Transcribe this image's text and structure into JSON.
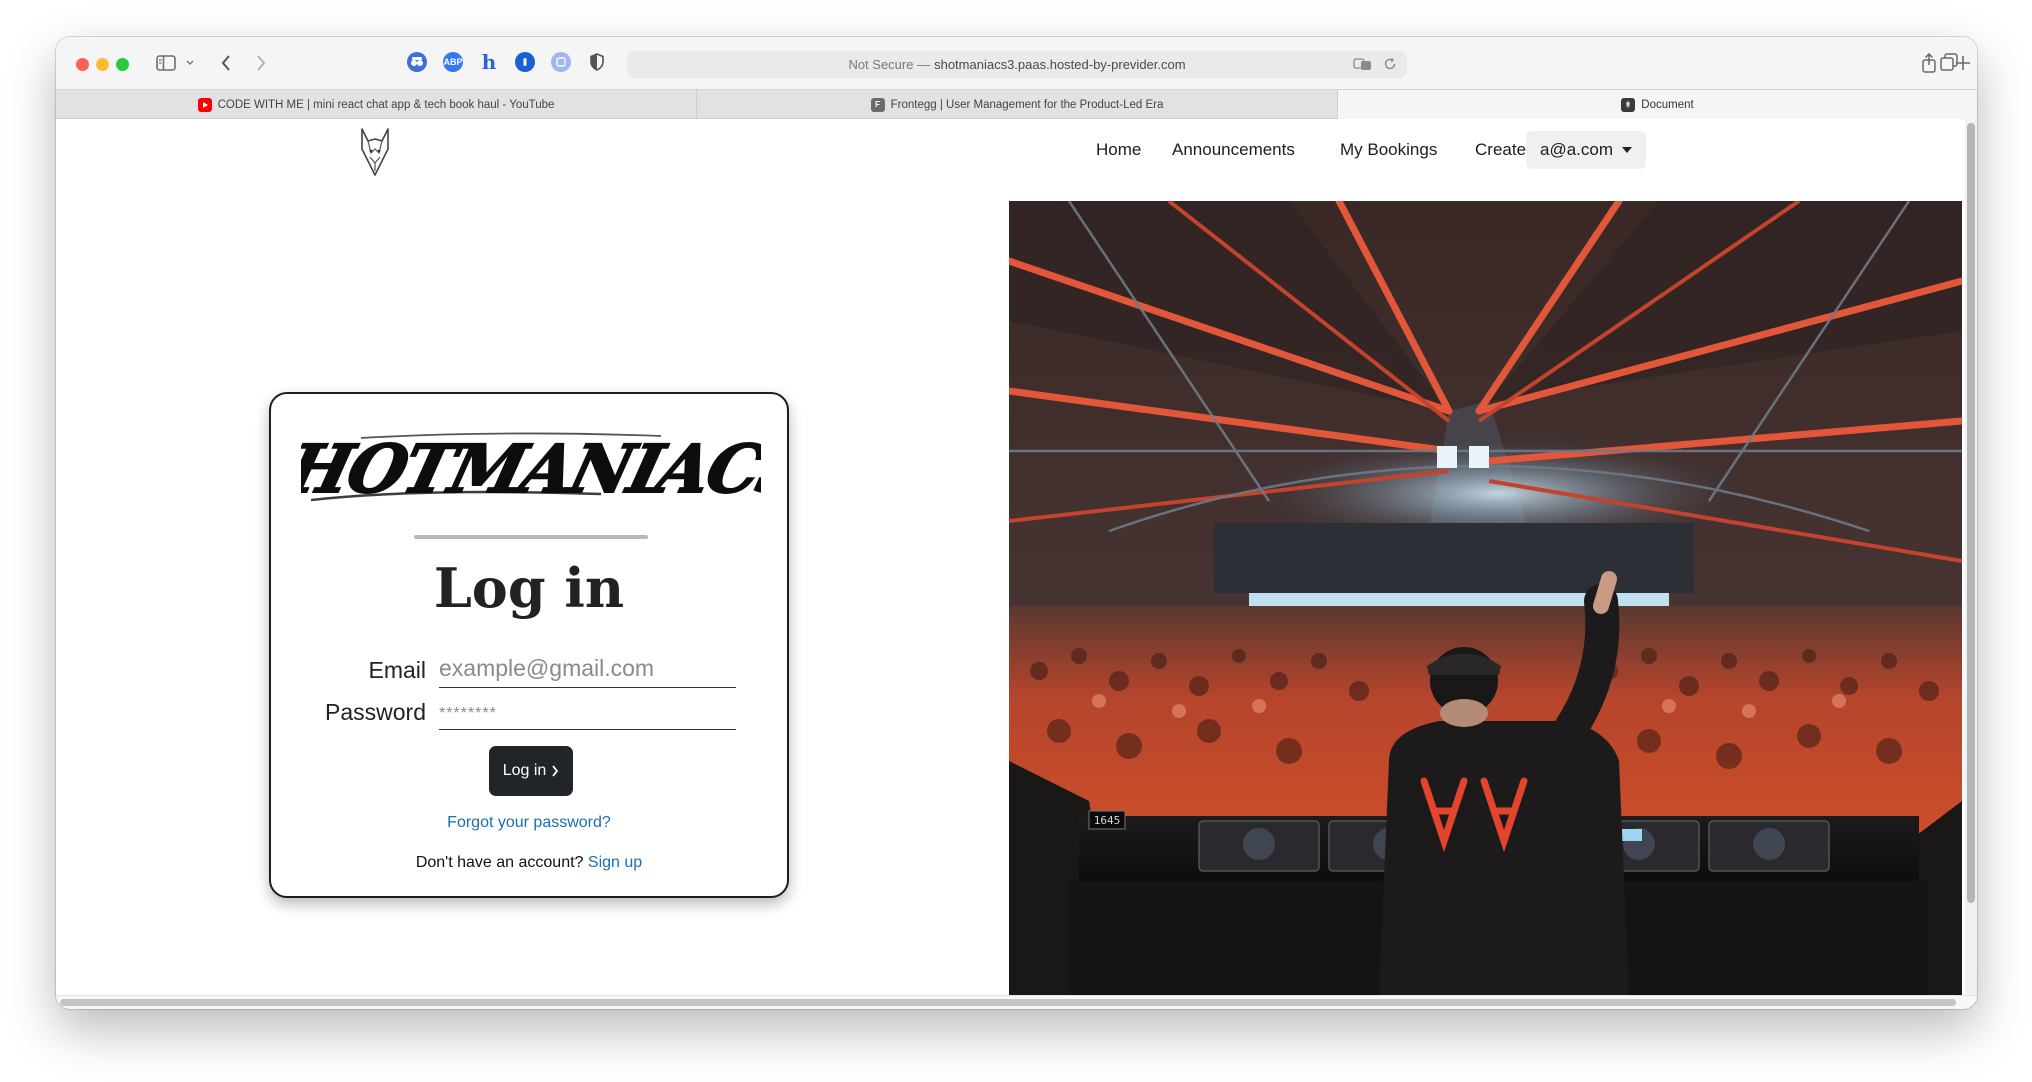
{
  "browser": {
    "address": {
      "security": "Not Secure —",
      "url": "shotmaniacs3.paas.hosted-by-previder.com"
    },
    "tabs": [
      {
        "label": "CODE WITH ME | mini react chat app & tech book haul - YouTube",
        "favicon": "youtube-icon",
        "favicon_color": "#ff0000"
      },
      {
        "label": "Frontegg | User Management for the Product-Led Era",
        "favicon": "frontegg-icon",
        "favicon_color": "#6b6b6b",
        "favicon_letter": "F"
      },
      {
        "label": "Document",
        "favicon": "document-icon",
        "favicon_color": "#3a3a3a"
      }
    ],
    "extensions": [
      {
        "name": "privacy-extension-icon",
        "color": "#3d6fd8"
      },
      {
        "name": "abp-icon",
        "color": "#3478f6",
        "text": "ABP"
      },
      {
        "name": "honey-h-icon",
        "color": "#2d63d9",
        "text": "h"
      },
      {
        "name": "onepassword-icon",
        "color": "#1a5fd6"
      },
      {
        "name": "translate-extension-icon",
        "color": "#9fb8f0"
      },
      {
        "name": "shield-icon",
        "color": "#555555"
      }
    ]
  },
  "nav": {
    "items": [
      "Home",
      "Announcements",
      "My Bookings",
      "Create Booking"
    ],
    "user": "a@a.com"
  },
  "login": {
    "brand": "SHOTMANIACS.",
    "title": "Log in",
    "email_label": "Email",
    "email_placeholder": "example@gmail.com",
    "password_label": "Password",
    "password_placeholder": "********",
    "button": "Log in",
    "forgot": "Forgot your password?",
    "no_account": "Don't have an account?",
    "signup": "Sign up"
  },
  "hero": {
    "deck_clock": "1645"
  },
  "colors": {
    "link": "#1a6fb0",
    "button": "#212529",
    "traffic_close": "#fe5f57",
    "traffic_min": "#febc2e",
    "traffic_max": "#28c840"
  }
}
